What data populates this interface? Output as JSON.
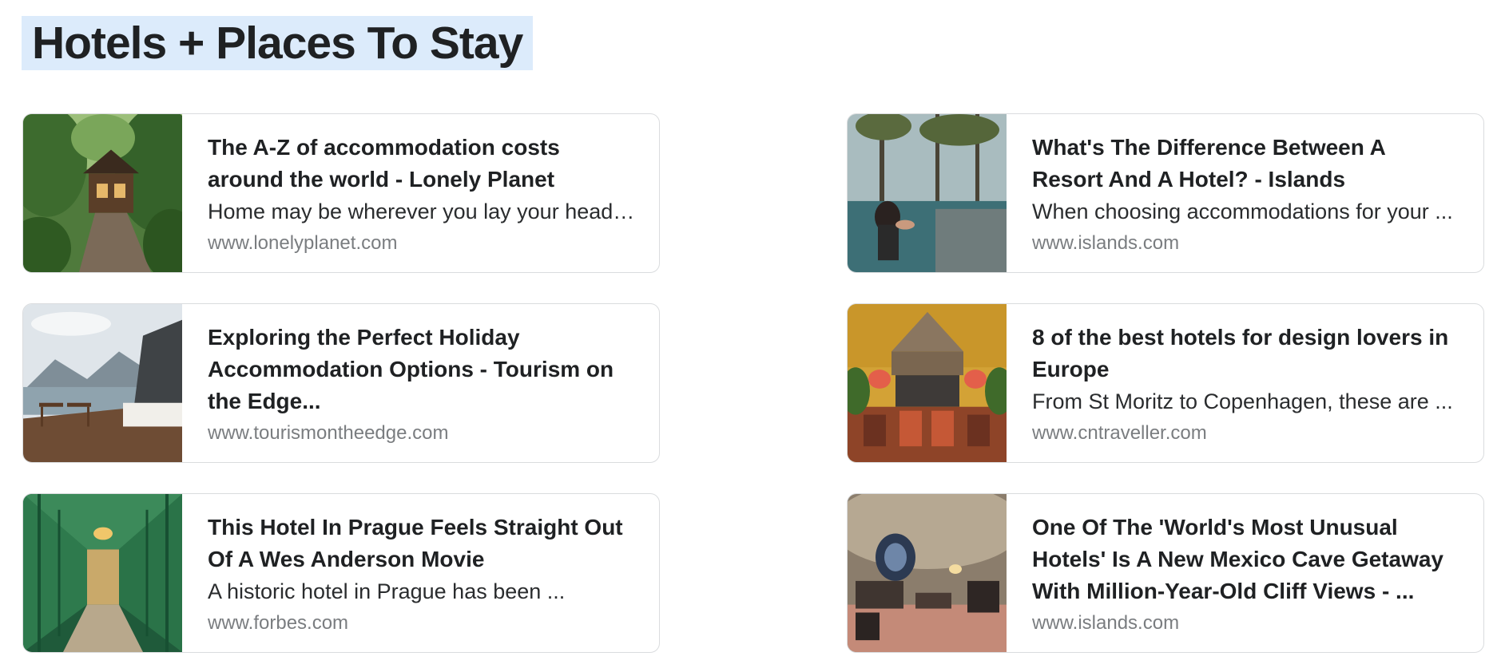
{
  "section": {
    "title": "Hotels + Places To Stay"
  },
  "cards": [
    {
      "title": "The A-Z of accommodation costs around the world - Lonely Planet",
      "snippet": "Home may be wherever you lay your head,...",
      "domain": "www.lonelyplanet.com",
      "image": "jungle-lodge-photo"
    },
    {
      "title": "What's The Difference Between A Resort And A Hotel? - Islands",
      "snippet": "When choosing accommodations for your ...",
      "domain": "www.islands.com",
      "image": "infinity-pool-photo"
    },
    {
      "title": "Exploring the Perfect Holiday Accommodation Options - Tourism on the Edge...",
      "snippet": "",
      "domain": "www.tourismontheedge.com",
      "image": "mountain-deck-photo"
    },
    {
      "title": "8 of the best hotels for design lovers in Europe",
      "snippet": "From St Moritz to Copenhagen, these are ...",
      "domain": "www.cntraveller.com",
      "image": "hotel-bar-photo"
    },
    {
      "title": "This Hotel In Prague Feels Straight Out Of A Wes Anderson Movie",
      "snippet": "A historic hotel in Prague has been ...",
      "domain": "www.forbes.com",
      "image": "green-corridor-photo"
    },
    {
      "title": "One Of The 'World's Most Unusual Hotels' Is A New Mexico Cave Getaway With Million-Year-Old Cliff Views - ...",
      "snippet": "",
      "domain": "www.islands.com",
      "image": "cave-room-photo"
    }
  ]
}
